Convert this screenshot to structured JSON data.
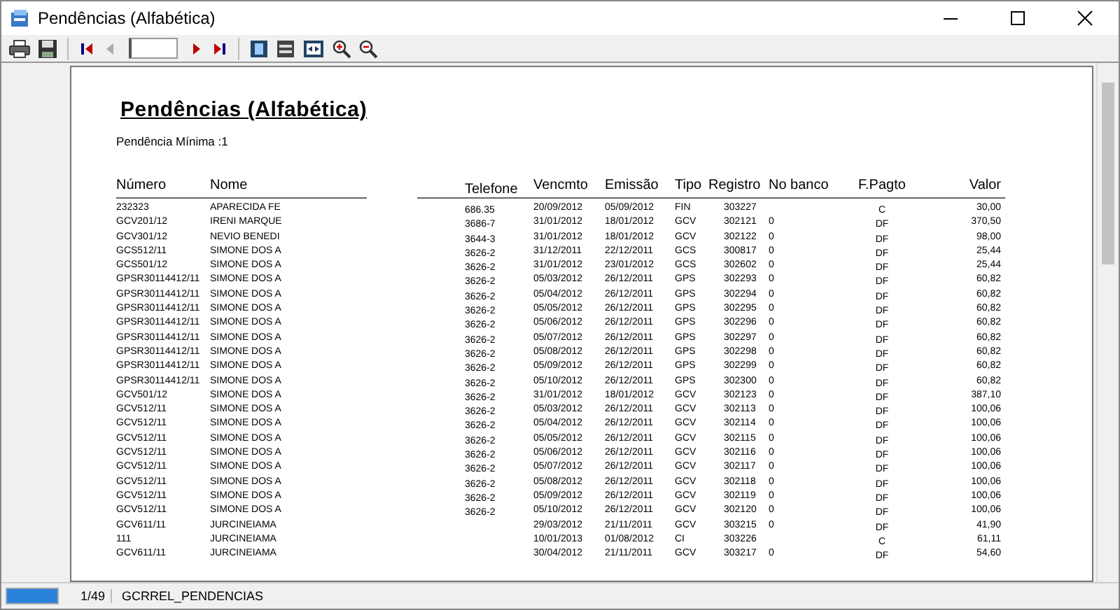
{
  "window": {
    "title": "Pendências (Alfabética)"
  },
  "toolbar": [
    {
      "kind": "print",
      "disabled": false
    },
    {
      "kind": "save",
      "disabled": false
    },
    {
      "kind": "sep"
    },
    {
      "kind": "first",
      "disabled": false
    },
    {
      "kind": "prev",
      "disabled": true
    },
    {
      "kind": "page"
    },
    {
      "kind": "next",
      "disabled": false
    },
    {
      "kind": "last",
      "disabled": false
    },
    {
      "kind": "sep"
    },
    {
      "kind": "page-view",
      "disabled": false
    },
    {
      "kind": "page-width",
      "disabled": false
    },
    {
      "kind": "fit",
      "disabled": false
    },
    {
      "kind": "zoom-in",
      "disabled": false
    },
    {
      "kind": "zoom-out",
      "disabled": false
    }
  ],
  "report": {
    "title": "Pendências (Alfabética)",
    "subtitle": "Pendência Mínima :1",
    "columns": [
      "Número",
      "Nome",
      "Telefone",
      "Vencmto",
      "Emissão",
      "Tipo",
      "Registro",
      "No banco",
      "F.Pagto",
      "Valor"
    ],
    "rows": [
      [
        "232323",
        "APARECIDA FE",
        "686.35",
        "20/09/2012",
        "05/09/2012",
        "FIN",
        "303227",
        "",
        "C",
        "30,00"
      ],
      [
        "GCV201/12",
        "IRENI MARQUE",
        "3686-7",
        "31/01/2012",
        "18/01/2012",
        "GCV",
        "302121",
        "0",
        "DF",
        "370,50"
      ],
      [
        "GCV301/12",
        "NEVIO BENEDI",
        "3644-3",
        "31/01/2012",
        "18/01/2012",
        "GCV",
        "302122",
        "0",
        "DF",
        "98,00"
      ],
      [
        "GCS512/11",
        "SIMONE DOS A",
        "3626-2",
        "31/12/2011",
        "22/12/2011",
        "GCS",
        "300817",
        "0",
        "DF",
        "25,44"
      ],
      [
        "GCS501/12",
        "SIMONE DOS A",
        "3626-2",
        "31/01/2012",
        "23/01/2012",
        "GCS",
        "302602",
        "0",
        "DF",
        "25,44"
      ],
      [
        "GPSR30114412/11",
        "SIMONE DOS A",
        "3626-2",
        "05/03/2012",
        "26/12/2011",
        "GPS",
        "302293",
        "0",
        "DF",
        "60,82"
      ],
      [
        "GPSR30114412/11",
        "SIMONE DOS A",
        "3626-2",
        "05/04/2012",
        "26/12/2011",
        "GPS",
        "302294",
        "0",
        "DF",
        "60,82"
      ],
      [
        "GPSR30114412/11",
        "SIMONE DOS A",
        "3626-2",
        "05/05/2012",
        "26/12/2011",
        "GPS",
        "302295",
        "0",
        "DF",
        "60,82"
      ],
      [
        "GPSR30114412/11",
        "SIMONE DOS A",
        "3626-2",
        "05/06/2012",
        "26/12/2011",
        "GPS",
        "302296",
        "0",
        "DF",
        "60,82"
      ],
      [
        "GPSR30114412/11",
        "SIMONE DOS A",
        "3626-2",
        "05/07/2012",
        "26/12/2011",
        "GPS",
        "302297",
        "0",
        "DF",
        "60,82"
      ],
      [
        "GPSR30114412/11",
        "SIMONE DOS A",
        "3626-2",
        "05/08/2012",
        "26/12/2011",
        "GPS",
        "302298",
        "0",
        "DF",
        "60,82"
      ],
      [
        "GPSR30114412/11",
        "SIMONE DOS A",
        "3626-2",
        "05/09/2012",
        "26/12/2011",
        "GPS",
        "302299",
        "0",
        "DF",
        "60,82"
      ],
      [
        "GPSR30114412/11",
        "SIMONE DOS A",
        "3626-2",
        "05/10/2012",
        "26/12/2011",
        "GPS",
        "302300",
        "0",
        "DF",
        "60,82"
      ],
      [
        "GCV501/12",
        "SIMONE DOS A",
        "3626-2",
        "31/01/2012",
        "18/01/2012",
        "GCV",
        "302123",
        "0",
        "DF",
        "387,10"
      ],
      [
        "GCV512/11",
        "SIMONE DOS A",
        "3626-2",
        "05/03/2012",
        "26/12/2011",
        "GCV",
        "302113",
        "0",
        "DF",
        "100,06"
      ],
      [
        "GCV512/11",
        "SIMONE DOS A",
        "3626-2",
        "05/04/2012",
        "26/12/2011",
        "GCV",
        "302114",
        "0",
        "DF",
        "100,06"
      ],
      [
        "GCV512/11",
        "SIMONE DOS A",
        "3626-2",
        "05/05/2012",
        "26/12/2011",
        "GCV",
        "302115",
        "0",
        "DF",
        "100,06"
      ],
      [
        "GCV512/11",
        "SIMONE DOS A",
        "3626-2",
        "05/06/2012",
        "26/12/2011",
        "GCV",
        "302116",
        "0",
        "DF",
        "100,06"
      ],
      [
        "GCV512/11",
        "SIMONE DOS A",
        "3626-2",
        "05/07/2012",
        "26/12/2011",
        "GCV",
        "302117",
        "0",
        "DF",
        "100,06"
      ],
      [
        "GCV512/11",
        "SIMONE DOS A",
        "3626-2",
        "05/08/2012",
        "26/12/2011",
        "GCV",
        "302118",
        "0",
        "DF",
        "100,06"
      ],
      [
        "GCV512/11",
        "SIMONE DOS A",
        "3626-2",
        "05/09/2012",
        "26/12/2011",
        "GCV",
        "302119",
        "0",
        "DF",
        "100,06"
      ],
      [
        "GCV512/11",
        "SIMONE DOS A",
        "3626-2",
        "05/10/2012",
        "26/12/2011",
        "GCV",
        "302120",
        "0",
        "DF",
        "100,06"
      ],
      [
        "GCV611/11",
        "JURCINEIAMA",
        "",
        "29/03/2012",
        "21/11/2011",
        "GCV",
        "303215",
        "0",
        "DF",
        "41,90"
      ],
      [
        "111",
        "JURCINEIAMA",
        "",
        "10/01/2013",
        "01/08/2012",
        "CI",
        "303226",
        "",
        "C",
        "61,11"
      ],
      [
        "GCV611/11",
        "JURCINEIAMA",
        "",
        "30/04/2012",
        "21/11/2011",
        "GCV",
        "303217",
        "0",
        "DF",
        "54,60"
      ]
    ]
  },
  "status_bar": {
    "progress": {
      "level": 1
    },
    "page": "1/49",
    "report_name": "GCRREL_PENDENCIAS"
  }
}
